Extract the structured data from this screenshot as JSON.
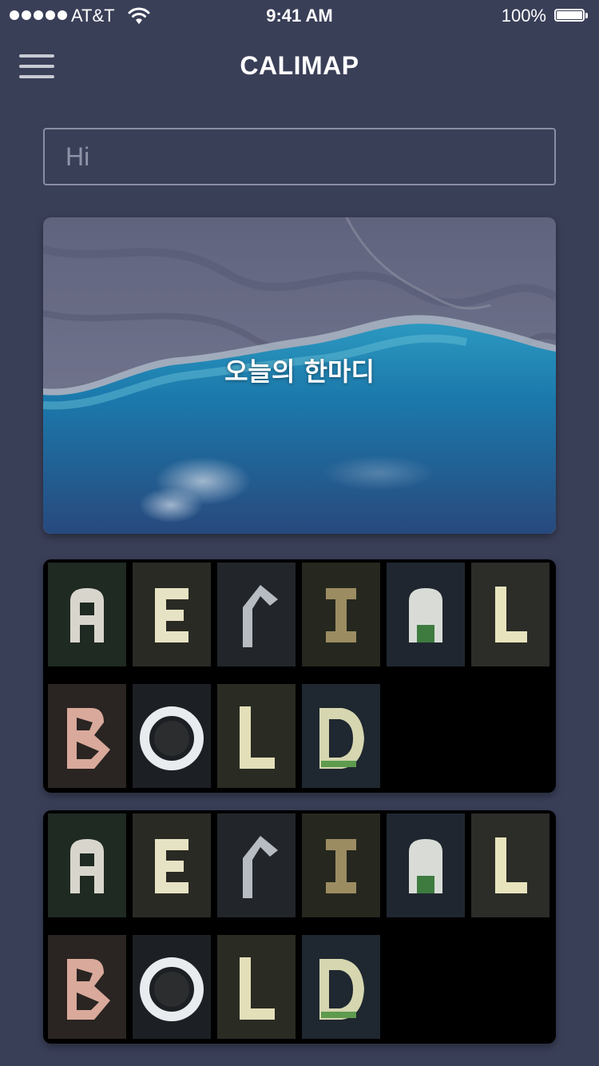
{
  "status_bar": {
    "carrier": "AT&T",
    "time": "9:41 AM",
    "battery": "100%",
    "icons": [
      "signal-dots-icon",
      "wifi-icon",
      "battery-icon"
    ]
  },
  "nav": {
    "title": "CALIMAP",
    "menu_icon": "hamburger-menu-icon"
  },
  "search": {
    "value": "Hi"
  },
  "hero": {
    "caption": "오늘의 한마디",
    "image": "aerial coastline photo"
  },
  "cards": [
    {
      "image": "aerial-bold-letters-image",
      "rows": [
        [
          "A",
          "E",
          "R",
          "I",
          "A",
          "L"
        ],
        [
          "B",
          "O",
          "L",
          "D"
        ]
      ]
    },
    {
      "image": "aerial-bold-letters-image",
      "rows": [
        [
          "A",
          "E",
          "R",
          "I",
          "A",
          "L"
        ],
        [
          "B",
          "O",
          "L",
          "D"
        ]
      ]
    }
  ],
  "colors": {
    "background": "#3a3f58",
    "text": "#ffffff",
    "search_border": "#8a8ea3",
    "search_text": "#8f93a8"
  }
}
